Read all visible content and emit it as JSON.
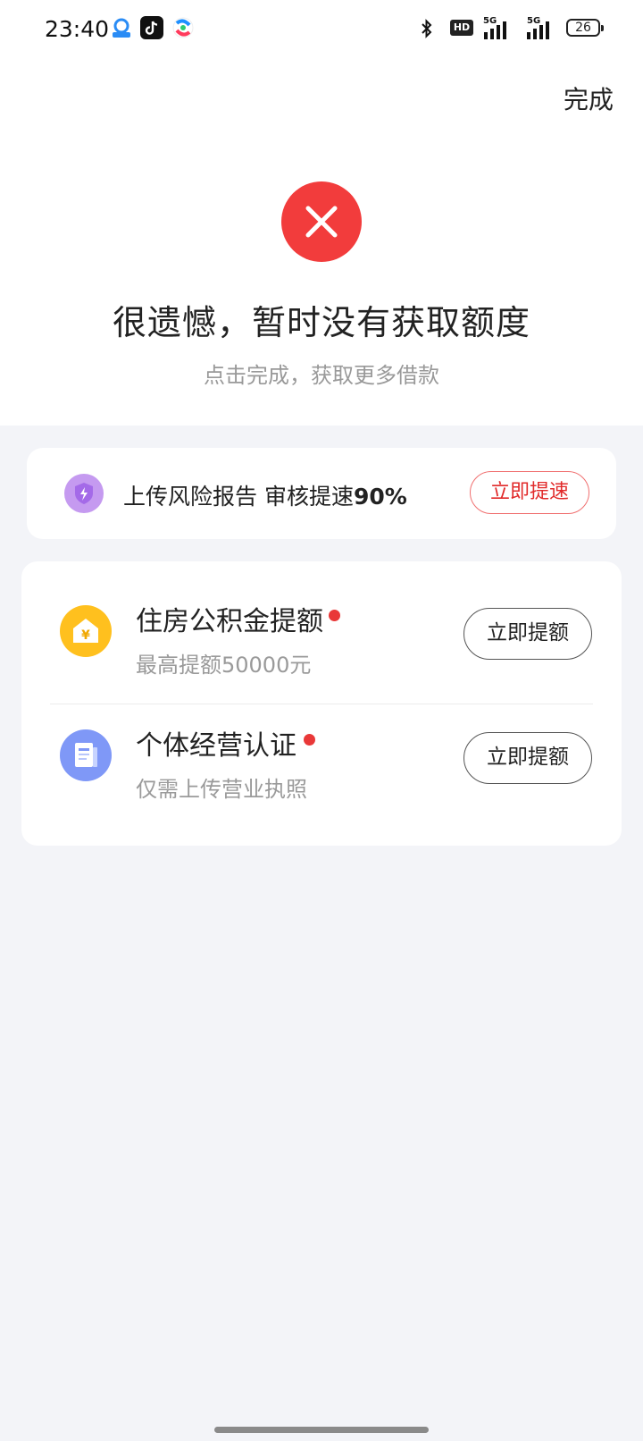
{
  "status_bar": {
    "time": "23:40",
    "network_hd": "HD",
    "signal_1": "5G",
    "signal_2": "5G",
    "battery": "26"
  },
  "header": {
    "done_label": "完成"
  },
  "result": {
    "icon": "close-x-icon",
    "title": "很遗憾，暂时没有获取额度",
    "subtitle": "点击完成，获取更多借款"
  },
  "risk_card": {
    "icon": "shield-lightning-icon",
    "text_prefix": "上传风险报告 审核提速",
    "text_highlight": "90%",
    "button_label": "立即提速"
  },
  "options": [
    {
      "icon": "house-yen-icon",
      "title": "住房公积金提额",
      "subtitle": "最高提额50000元",
      "button_label": "立即提额"
    },
    {
      "icon": "document-icon",
      "title": "个体经营认证",
      "subtitle": "仅需上传营业执照",
      "button_label": "立即提额"
    }
  ],
  "colors": {
    "fail_red": "#f23c3c",
    "accent_red": "#e12a2a",
    "house_icon_bg": "#ffc01e",
    "doc_icon_bg": "#7f98f7",
    "shield_bg": "#c59af0"
  }
}
